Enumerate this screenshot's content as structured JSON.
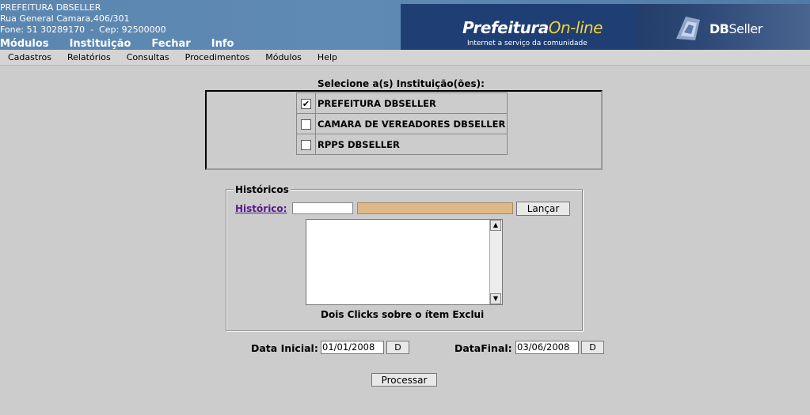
{
  "header": {
    "line1": "PREFEITURA DBSELLER",
    "line2": "Rua General Camara,406/301",
    "line3": "Fone: 51 30289170  -  Cep: 92500000",
    "nav": [
      "Módulos",
      "Instituição",
      "Fechar",
      "Info"
    ],
    "logo_title_a": "Prefeitura",
    "logo_title_b": "On-line",
    "logo_sub": "Internet a serviço da comunidade",
    "brand_a": "DB",
    "brand_b": "Seller"
  },
  "menu": [
    "Cadastros",
    "Relatórios",
    "Consultas",
    "Procedimentos",
    "Módulos",
    "Help"
  ],
  "instituicoes": {
    "title": "Selecione a(s) Instituição(ões):",
    "items": [
      {
        "label": "PREFEITURA DBSELLER",
        "checked": true
      },
      {
        "label": "CAMARA DE VEREADORES DBSELLER",
        "checked": false
      },
      {
        "label": "RPPS DBSELLER",
        "checked": false
      }
    ]
  },
  "historicos": {
    "legend": "Históricos",
    "link_label": "Histórico:",
    "code_value": "",
    "desc_value": "",
    "launch_button": "Lançar",
    "hint": "Dois Clicks sobre o ítem Exclui"
  },
  "datas": {
    "inicial_label": "Data Inicial:",
    "inicial_value": "01/01/2008",
    "final_label": "DataFinal:",
    "final_value": "03/06/2008",
    "d_button": "D"
  },
  "process_button": "Processar",
  "colors": {
    "header_bg": "#5b86b0",
    "logo_bg": "#1f3f74",
    "readonly_field": "#deb887",
    "page_bg": "#cccccc",
    "link": "#551a8b"
  }
}
